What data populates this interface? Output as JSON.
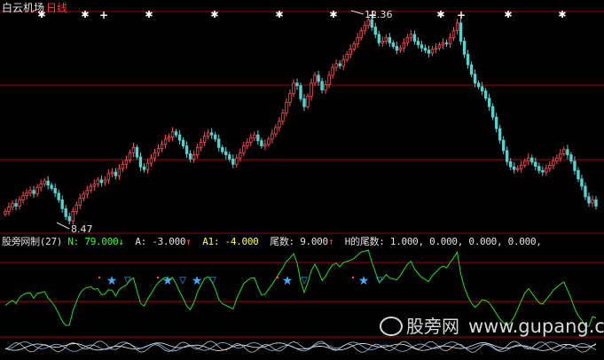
{
  "title": {
    "stock": "白云机场",
    "period": "日线"
  },
  "price_labels": {
    "high": "12.36",
    "low": "8.47"
  },
  "indicator": {
    "name": "股旁网制(27)",
    "n_label": "N:",
    "n_value": "79.000",
    "n_arrow": "↓",
    "a_label": "A:",
    "a_value": "-3.000",
    "a_arrow": "↑",
    "a1_label": "A1:",
    "a1_value": "-4.000",
    "tail_label": "尾数:",
    "tail_value": "9.000",
    "tail_arrow": "↑",
    "h_tail_label": "H的尾数:",
    "h_tail_values": "1.000, 0.000, 0.000, 0.000,"
  },
  "watermark": {
    "text": "股旁网",
    "url": "www.gupang.com"
  },
  "colors": {
    "background": "#000000",
    "up": "#ff5050",
    "down": "#54d2d2",
    "grid": "#a00000",
    "indicator_line": "#22dd22"
  },
  "chart_data": {
    "type": "candlestick",
    "high": 12.36,
    "low": 8.47,
    "ylim": [
      8.3,
      12.5
    ],
    "close": [
      8.7,
      8.78,
      8.85,
      8.8,
      8.92,
      9.0,
      9.05,
      9.1,
      9.04,
      9.16,
      9.22,
      9.28,
      9.2,
      9.14,
      9.05,
      8.92,
      8.75,
      8.6,
      8.52,
      8.7,
      8.82,
      8.95,
      9.03,
      9.1,
      9.18,
      9.22,
      9.3,
      9.25,
      9.3,
      9.42,
      9.45,
      9.38,
      9.52,
      9.6,
      9.68,
      9.82,
      9.92,
      9.74,
      9.55,
      9.5,
      9.62,
      9.72,
      9.82,
      9.9,
      9.98,
      10.08,
      10.12,
      10.22,
      10.16,
      10.06,
      9.95,
      9.8,
      9.7,
      9.78,
      9.92,
      10.02,
      10.14,
      10.2,
      10.16,
      10.08,
      9.92,
      9.84,
      9.78,
      9.7,
      9.6,
      9.72,
      9.82,
      9.95,
      10.02,
      10.1,
      10.16,
      10.05,
      9.95,
      9.98,
      10.08,
      10.18,
      10.3,
      10.42,
      10.58,
      10.78,
      10.95,
      11.15,
      11.1,
      10.85,
      10.7,
      10.9,
      11.15,
      11.3,
      11.18,
      11.02,
      11.12,
      11.3,
      11.45,
      11.52,
      11.48,
      11.6,
      11.7,
      11.8,
      11.9,
      12.02,
      12.15,
      12.25,
      12.36,
      12.22,
      12.08,
      11.92,
      11.95,
      12.02,
      11.92,
      11.85,
      11.78,
      11.82,
      11.92,
      12.02,
      12.08,
      11.95,
      11.88,
      11.82,
      11.78,
      11.72,
      11.8,
      11.82,
      11.88,
      11.92,
      11.9,
      12.02,
      12.15,
      12.3,
      11.95,
      11.7,
      11.5,
      11.32,
      11.15,
      11.08,
      11.0,
      10.86,
      10.7,
      10.5,
      10.28,
      10.06,
      9.86,
      9.65,
      9.55,
      9.5,
      9.52,
      9.58,
      9.66,
      9.72,
      9.64,
      9.56,
      9.48,
      9.45,
      9.52,
      9.58,
      9.66,
      9.72,
      9.8,
      9.88,
      9.78,
      9.66,
      9.48,
      9.32,
      9.18,
      8.98,
      8.86,
      8.92,
      8.8
    ]
  }
}
